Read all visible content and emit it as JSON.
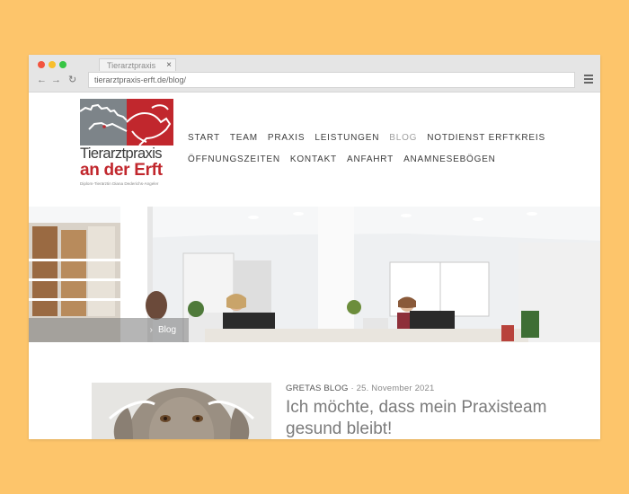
{
  "browser": {
    "tab_title": "Tierarztpraxis",
    "tab_close": "×",
    "back": "←",
    "forward": "→",
    "reload": "↻",
    "url": "tierarztpraxis-erft.de/blog/"
  },
  "logo": {
    "line1": "Tierarztpraxis",
    "line2": "an der Erft",
    "line3": "Diplom-Tierärztin Diana Dederichs-Angeler"
  },
  "nav": {
    "items": [
      {
        "label": "START",
        "active": false
      },
      {
        "label": "TEAM",
        "active": false
      },
      {
        "label": "PRAXIS",
        "active": false
      },
      {
        "label": "LEISTUNGEN",
        "active": false
      },
      {
        "label": "BLOG",
        "active": true
      },
      {
        "label": "NOTDIENST ERFTKREIS",
        "active": false
      },
      {
        "label": "ÖFFNUNGSZEITEN",
        "active": false
      },
      {
        "label": "KONTAKT",
        "active": false
      },
      {
        "label": "ANFAHRT",
        "active": false
      },
      {
        "label": "ANAMNESEBÖGEN",
        "active": false
      }
    ]
  },
  "hero": {
    "breadcrumb_sep": "›",
    "breadcrumb": "Blog"
  },
  "post": {
    "category": "GRETAS BLOG",
    "separator": " · ",
    "date": "25. November 2021",
    "title": "Ich möchte, dass mein Praxisteam gesund bleibt!"
  },
  "colors": {
    "background": "#fdc56b",
    "brand_red": "#c1272d",
    "logo_gray": "#7d8489"
  }
}
